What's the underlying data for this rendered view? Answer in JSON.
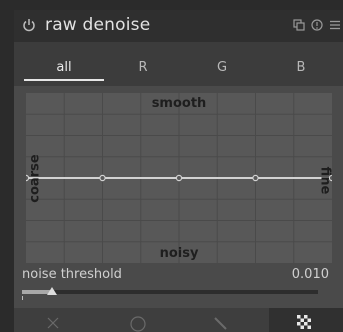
{
  "module": {
    "title": "raw denoise",
    "icons": [
      "power-icon",
      "copy-icon",
      "reset-icon",
      "presets-icon"
    ]
  },
  "tabs": [
    {
      "label": "all",
      "active": true
    },
    {
      "label": "R",
      "active": false
    },
    {
      "label": "G",
      "active": false
    },
    {
      "label": "B",
      "active": false
    }
  ],
  "graph": {
    "top_label": "smooth",
    "bottom_label": "noisy",
    "left_label": "coarse",
    "right_label": "fine",
    "curve_level": 0.5
  },
  "threshold": {
    "label": "noise threshold",
    "value": "0.010",
    "fraction": 0.1
  },
  "toolbar": {
    "icons": [
      "cross-icon",
      "circle-icon",
      "pencil-icon",
      "checker-icon"
    ]
  },
  "colors": {
    "accent": "#e6e6e6",
    "panel": "#4a4a4a",
    "graph_bg": "#585858"
  }
}
